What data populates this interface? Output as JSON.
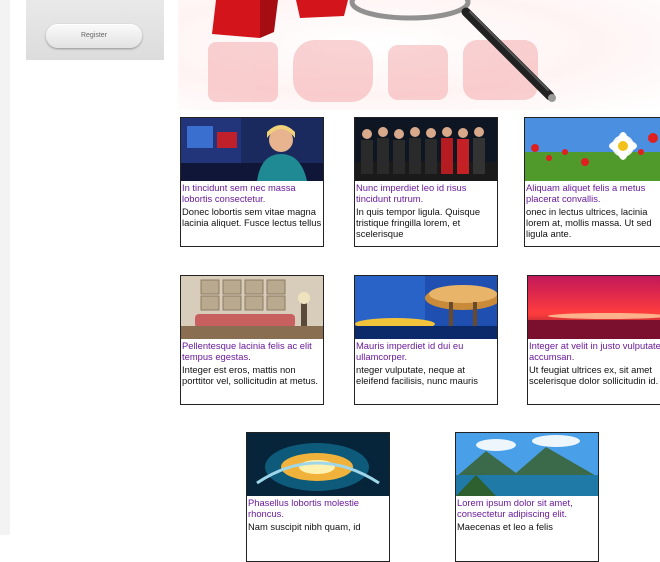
{
  "sidebar": {
    "register_label": "Register"
  },
  "cards": [
    {
      "title": "In tincidunt sem nec massa lobortis consectetur.",
      "desc": "Donec lobortis sem vitae magna lacinia aliquet. Fusce lectus tellus"
    },
    {
      "title": "Nunc imperdiet leo id risus tincidunt rutrum.",
      "desc": "In quis tempor ligula. Quisque tristique fringilla lorem, et scelerisque"
    },
    {
      "title": "Aliquam aliquet felis a metus placerat convallis.",
      "desc": "onec in lectus ultrices, lacinia lorem at, mollis massa. Ut sed ligula ante."
    },
    {
      "title": "Pellentesque lacinia felis ac elit tempus egestas.",
      "desc": "Integer est eros, mattis non porttitor vel, sollicitudin at metus."
    },
    {
      "title": "Mauris imperdiet id dui eu ullamcorper.",
      "desc": "nteger vulputate, neque at eleifend facilisis, nunc mauris"
    },
    {
      "title": "Integer at velit in justo vulputate accumsan.",
      "desc": "Ut feugiat ultrices ex, sit amet scelerisque dolor sollicitudin id."
    },
    {
      "title": "Phasellus lobortis molestie rhoncus.",
      "desc": "Nam suscipit nibh quam, id"
    },
    {
      "title": "Lorem ipsum dolor sit amet, consectetur adipiscing elit.",
      "desc": "Maecenas et leo a felis"
    }
  ],
  "colors": {
    "title_link": "#6a1b9a",
    "text": "#111111",
    "hero_red": "#e0161d"
  }
}
